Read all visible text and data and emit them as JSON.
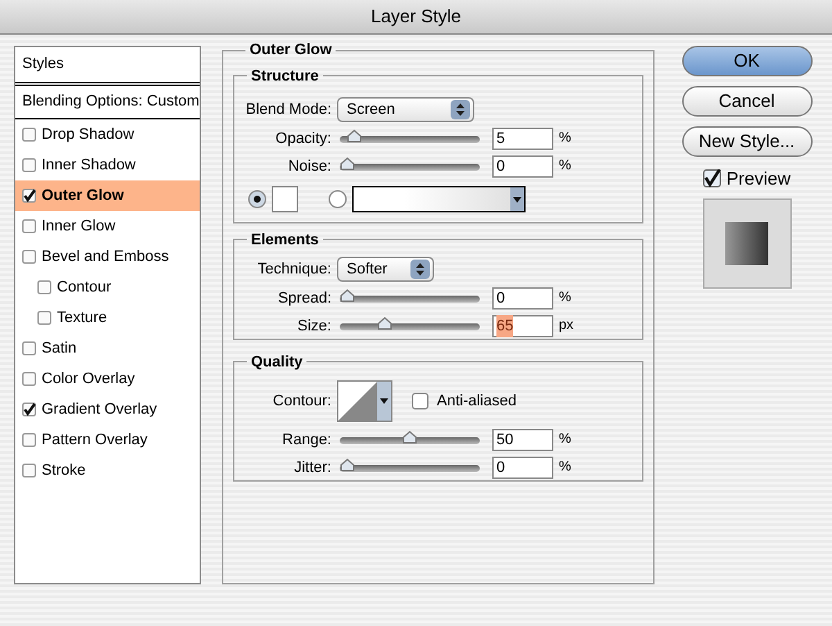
{
  "window": {
    "title": "Layer Style"
  },
  "styles_list": {
    "header": "Styles",
    "blending": "Blending Options: Custom",
    "items": [
      {
        "label": "Drop Shadow",
        "checked": false,
        "selected": false
      },
      {
        "label": "Inner Shadow",
        "checked": false,
        "selected": false
      },
      {
        "label": "Outer Glow",
        "checked": true,
        "selected": true
      },
      {
        "label": "Inner Glow",
        "checked": false,
        "selected": false
      },
      {
        "label": "Bevel and Emboss",
        "checked": false,
        "selected": false,
        "children": [
          {
            "label": "Contour",
            "checked": false,
            "selected": false
          },
          {
            "label": "Texture",
            "checked": false,
            "selected": false
          }
        ]
      },
      {
        "label": "Satin",
        "checked": false,
        "selected": false
      },
      {
        "label": "Color Overlay",
        "checked": false,
        "selected": false
      },
      {
        "label": "Gradient Overlay",
        "checked": true,
        "selected": false
      },
      {
        "label": "Pattern Overlay",
        "checked": false,
        "selected": false
      },
      {
        "label": "Stroke",
        "checked": false,
        "selected": false
      }
    ]
  },
  "panel": {
    "title": "Outer Glow",
    "structure": {
      "title": "Structure",
      "blend_mode": {
        "label": "Blend Mode:",
        "value": "Screen"
      },
      "sliders": [
        {
          "label": "Opacity:",
          "value": "5",
          "unit": "%",
          "level": 0.05,
          "highlighted": false
        },
        {
          "label": "Noise:",
          "value": "0",
          "unit": "%",
          "level": 0,
          "highlighted": false
        }
      ],
      "fill": [
        {
          "kind": "color",
          "selected": true
        },
        {
          "kind": "gradient",
          "selected": false
        }
      ]
    },
    "elements": {
      "title": "Elements",
      "technique": {
        "label": "Technique:",
        "value": "Softer"
      },
      "sliders": [
        {
          "label": "Spread:",
          "value": "0",
          "unit": "%",
          "level": 0,
          "highlighted": false
        },
        {
          "label": "Size:",
          "value": "65",
          "unit": "px",
          "level": 0.3,
          "highlighted": true
        }
      ]
    },
    "quality": {
      "title": "Quality",
      "contour": {
        "label": "Contour:"
      },
      "anti_aliased": {
        "label": "Anti-aliased",
        "checked": false
      },
      "sliders": [
        {
          "label": "Range:",
          "value": "50",
          "unit": "%",
          "level": 0.5,
          "highlighted": false
        },
        {
          "label": "Jitter:",
          "value": "0",
          "unit": "%",
          "level": 0,
          "highlighted": false
        }
      ]
    }
  },
  "buttons": [
    {
      "label": "OK",
      "default": true
    },
    {
      "label": "Cancel",
      "default": false
    },
    {
      "label": "New Style...",
      "default": false
    }
  ],
  "preview": {
    "label": "Preview",
    "checked": true
  }
}
